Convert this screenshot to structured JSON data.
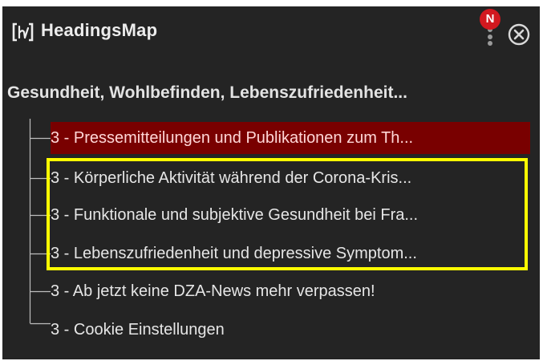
{
  "header": {
    "logo_icon": "headingsmap-logo-icon",
    "title": "HeadingsMap",
    "notification_badge": "N",
    "menu_icon": "vertical-dots-icon",
    "close_icon": "close-circle-icon"
  },
  "document": {
    "title": "Gesundheit, Wohlbefinden, Lebenszufriedenheit..."
  },
  "headings": [
    {
      "text": "3 -  Pressemitteilungen und Publikationen zum Th...",
      "level": 3,
      "selected": true
    },
    {
      "text": "3 -  Körperliche Aktivität während der Corona-Kris...",
      "level": 3,
      "selected": false,
      "highlighted": true
    },
    {
      "text": "3 -  Funktionale und subjektive Gesundheit bei Fra...",
      "level": 3,
      "selected": false,
      "highlighted": true
    },
    {
      "text": "3 -  Lebenszufriedenheit und depressive Symptom...",
      "level": 3,
      "selected": false,
      "highlighted": true
    },
    {
      "text": "3 - Ab jetzt keine DZA-News mehr verpassen!",
      "level": 3,
      "selected": false
    },
    {
      "text": "3 - Cookie Einstellungen",
      "level": 3,
      "selected": false
    }
  ],
  "colors": {
    "panel_background": "#242424",
    "selected_background": "#790000",
    "highlight_border": "#ffff00",
    "badge": "#d2181f"
  }
}
